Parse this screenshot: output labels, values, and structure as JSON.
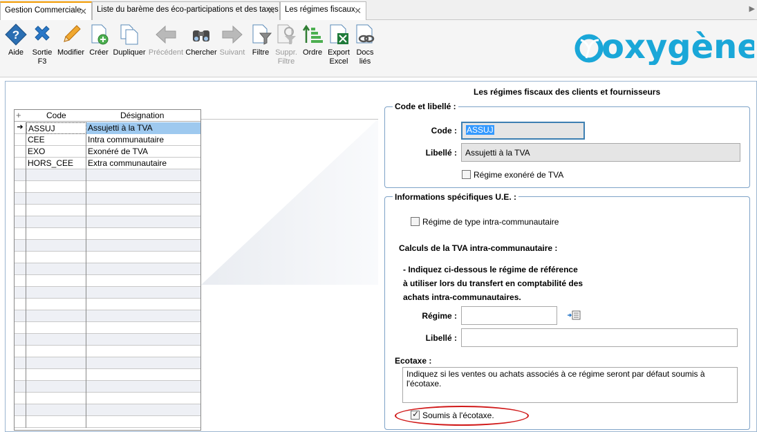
{
  "tabs": [
    {
      "label": "Gestion Commerciale"
    },
    {
      "label": "Liste du barème des éco-participations et des taxes"
    },
    {
      "label": "Les régimes fiscaux"
    }
  ],
  "toolbar": {
    "aide": "Aide",
    "sortie": "Sortie",
    "sortie_key": "F3",
    "modifier": "Modifier",
    "creer": "Créer",
    "dupliquer": "Dupliquer",
    "precedent": "Précédent",
    "chercher": "Chercher",
    "suivant": "Suivant",
    "filtre": "Filtre",
    "suppr_filtre_1": "Suppr.",
    "suppr_filtre_2": "Filtre",
    "ordre": "Ordre",
    "export_1": "Export",
    "export_2": "Excel",
    "docs_1": "Docs",
    "docs_2": "liés"
  },
  "logo_text": "oxygène",
  "page_title": "Les régimes fiscaux des clients et fournisseurs",
  "grid": {
    "col_code": "Code",
    "col_designation": "Désignation",
    "rows": [
      {
        "code": "ASSUJ",
        "designation": "Assujetti à la TVA"
      },
      {
        "code": "CEE",
        "designation": "Intra communautaire"
      },
      {
        "code": "EXO",
        "designation": "Exonéré de TVA"
      },
      {
        "code": "HORS_CEE",
        "designation": "Extra communautaire"
      }
    ]
  },
  "code_libelle": {
    "title": "Code et libellé :",
    "code_label": "Code :",
    "code_value": "ASSUJ",
    "libelle_label": "Libellé :",
    "libelle_value": "Assujetti à la TVA",
    "exonere_label": "Régime exonéré de TVA",
    "exonere_checked": false
  },
  "infos_ue": {
    "title": "Informations spécifiques U.E. :",
    "intra_label": "Régime de type intra-communautaire",
    "intra_checked": false,
    "calculs_title": "Calculs de la TVA intra-communautaire :",
    "instruction_1": "- Indiquez ci-dessous le régime de référence",
    "instruction_2": "à utiliser lors du transfert en comptabilité des",
    "instruction_3": "achats intra-communautaires.",
    "regime_label": "Régime :",
    "regime_value": "",
    "libelle_label": "Libellé :",
    "libelle_value": "",
    "ecotaxe_title": "Ecotaxe :",
    "ecotaxe_text": "Indiquez si les ventes ou achats associés à ce régime seront par défaut soumis à l'écotaxe.",
    "soumis_label": "Soumis à l'écotaxe.",
    "soumis_checked": true
  }
}
